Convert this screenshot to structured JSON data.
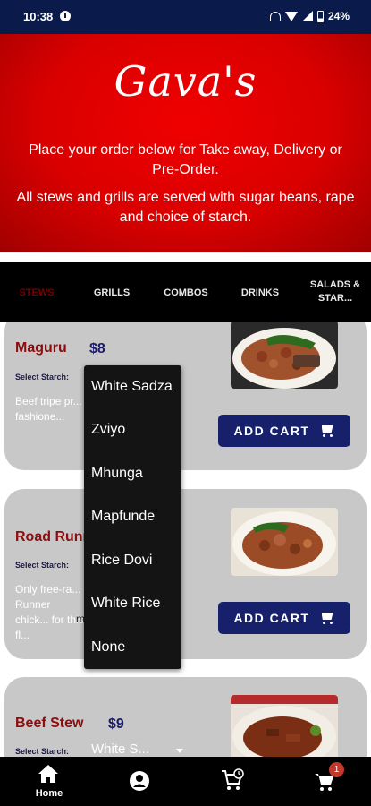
{
  "status_bar": {
    "time": "10:38",
    "battery": "24%"
  },
  "hero": {
    "brand": "Gava's",
    "line1": "Place your order below for Take away, Delivery or Pre-Order.",
    "line2": "All stews and grills are served with sugar beans, rape and choice of starch."
  },
  "tabs": [
    {
      "label": "STEWS",
      "active": true
    },
    {
      "label": "GRILLS",
      "active": false
    },
    {
      "label": "COMBOS",
      "active": false
    },
    {
      "label": "DRINKS",
      "active": false
    },
    {
      "label": "SALADS & STAR...",
      "active": false
    }
  ],
  "items": [
    {
      "name": "Maguru",
      "price": "$8",
      "starch_label": "Select Starch:",
      "description": "Beef tripe pr... old-fashione...",
      "add_label": "ADD CART"
    },
    {
      "name": "Road Runn...",
      "price": "",
      "starch_label": "Select Starch:",
      "description": "Only free-ra... Runner chick... for this fl...",
      "more": "m...",
      "add_label": "ADD CART"
    },
    {
      "name": "Beef Stew",
      "price": "$9",
      "starch_label": "Select Starch:",
      "selected_starch": "White S..."
    }
  ],
  "dropdown_options": [
    "White Sadza",
    "Zviyo",
    "Mhunga",
    "Mapfunde",
    "Rice Dovi",
    "White Rice",
    "None"
  ],
  "bottom_nav": {
    "home_label": "Home",
    "cart_badge": "1"
  },
  "colors": {
    "accent_red": "#d90000",
    "dark_navy": "#17206a",
    "item_red": "#8b0d0d"
  }
}
